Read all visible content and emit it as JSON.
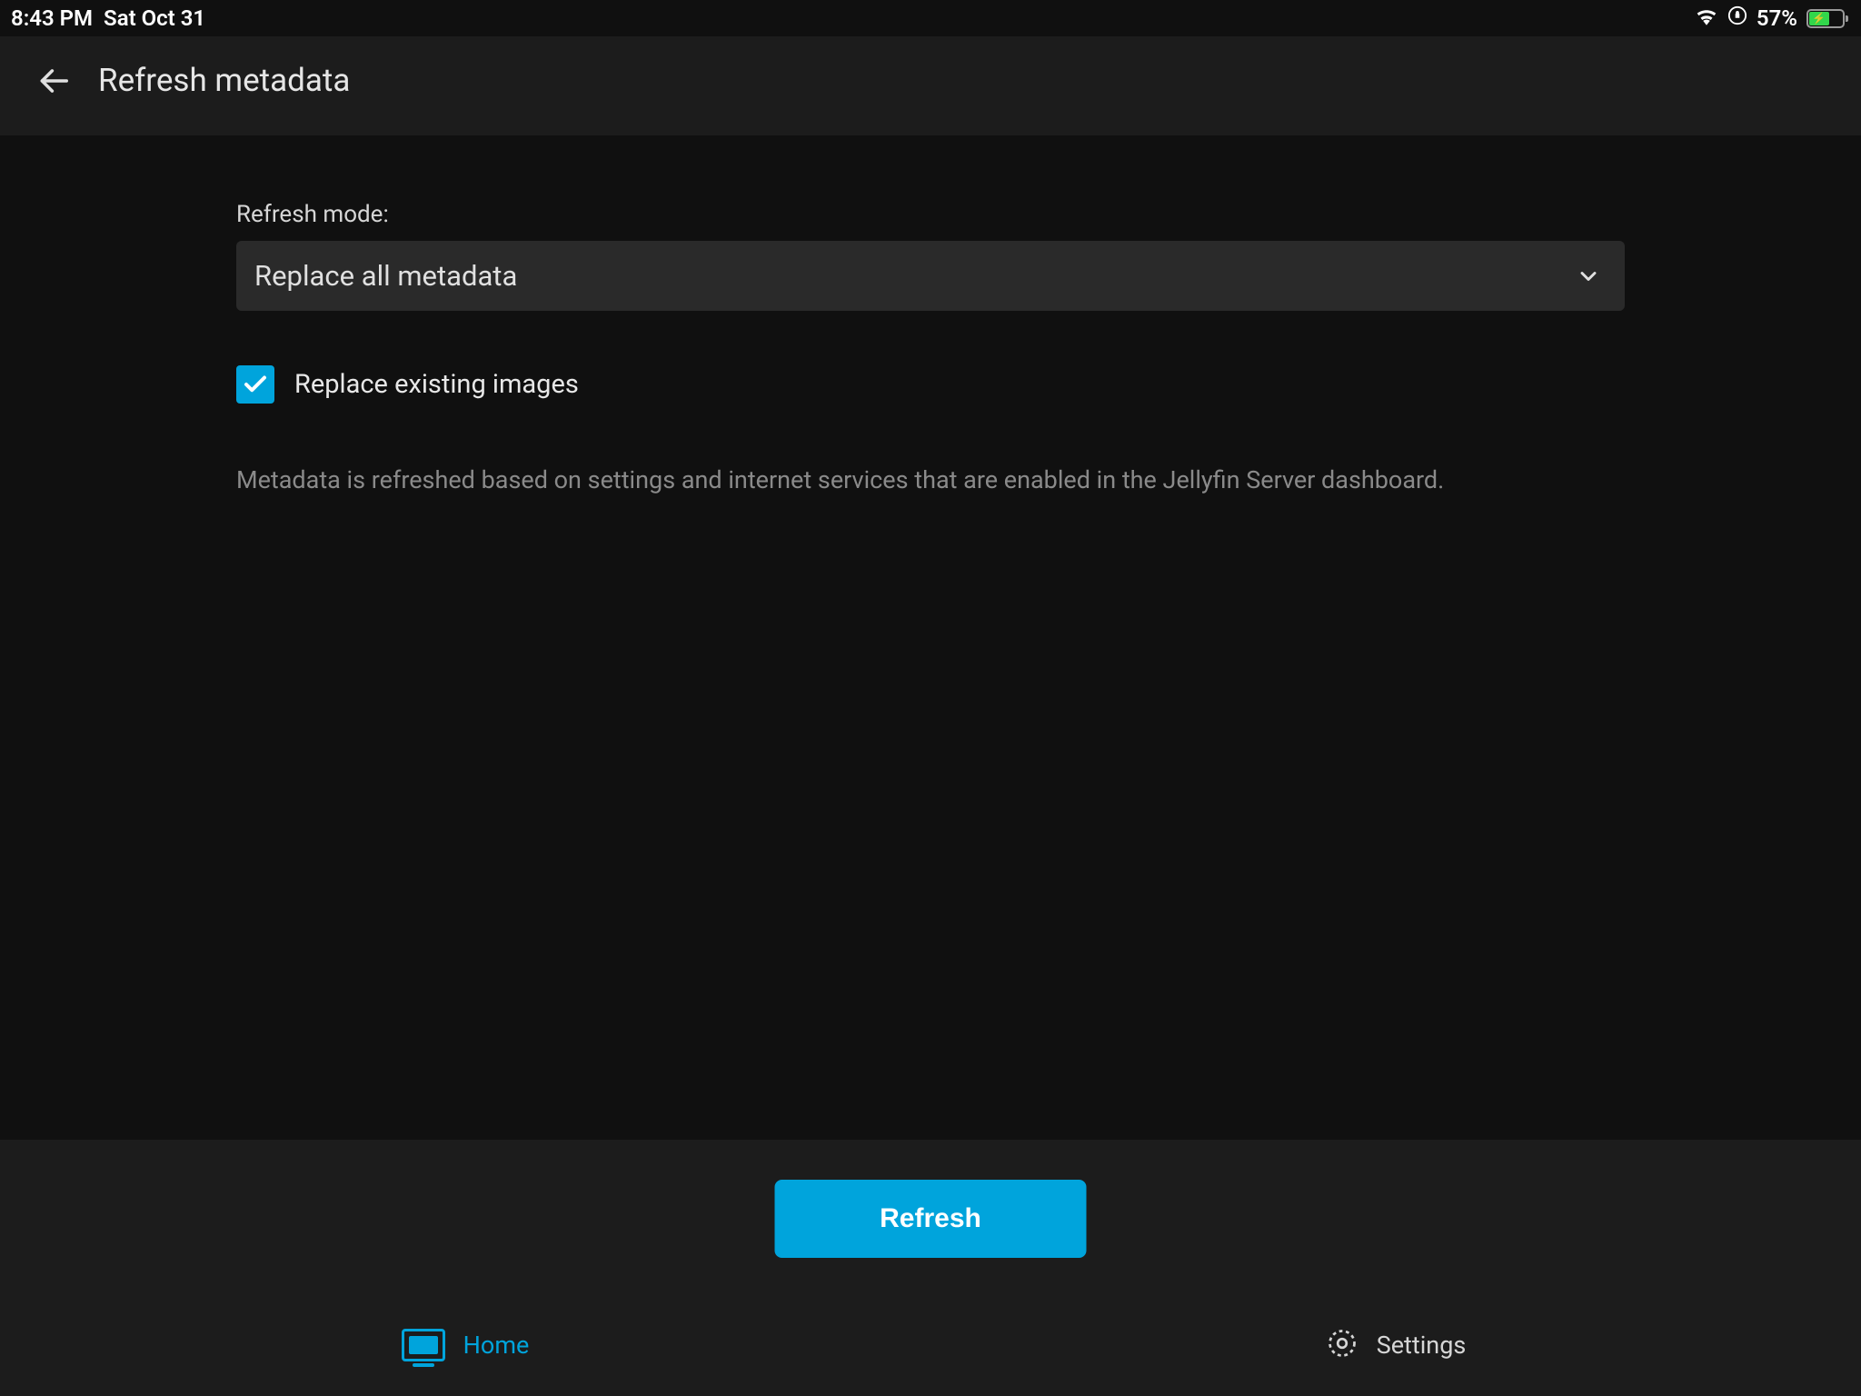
{
  "statusBar": {
    "time": "8:43 PM",
    "date": "Sat Oct 31",
    "batteryPercent": "57%"
  },
  "header": {
    "title": "Refresh metadata"
  },
  "form": {
    "refreshModeLabel": "Refresh mode:",
    "refreshModeValue": "Replace all metadata",
    "replaceImagesLabel": "Replace existing images",
    "helpText": "Metadata is refreshed based on settings and internet services that are enabled in the Jellyfin Server dashboard."
  },
  "actions": {
    "refreshButton": "Refresh"
  },
  "nav": {
    "home": "Home",
    "settings": "Settings"
  }
}
